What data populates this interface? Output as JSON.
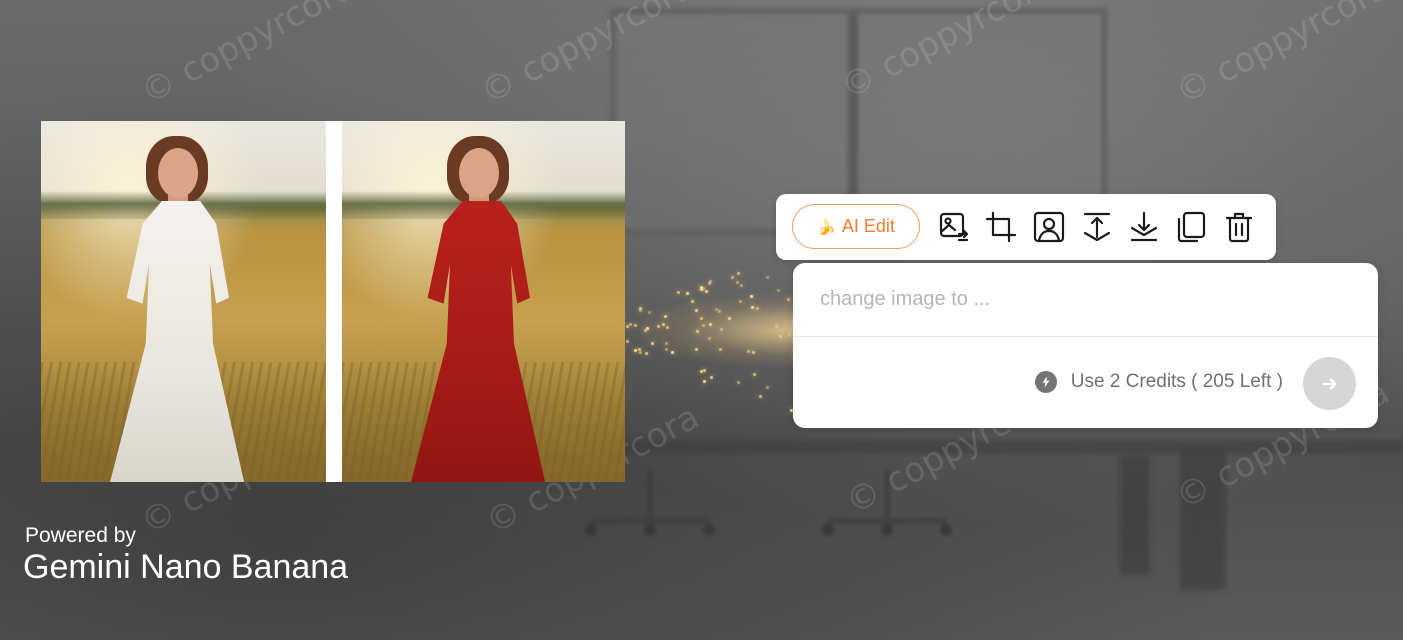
{
  "watermark_text": "© coppyrcora",
  "footer": {
    "powered_label": "Powered by",
    "product_name": "Gemini Nano Banana"
  },
  "toolbar": {
    "ai_edit_label": "AI Edit",
    "ai_edit_emoji": "🍌",
    "accent_color": "#f07c2d",
    "tools": [
      {
        "name": "image-replace-icon"
      },
      {
        "name": "crop-icon"
      },
      {
        "name": "portrait-icon"
      },
      {
        "name": "expand-vertical-icon"
      },
      {
        "name": "compress-vertical-icon"
      },
      {
        "name": "duplicate-icon"
      },
      {
        "name": "delete-icon"
      }
    ]
  },
  "prompt": {
    "placeholder": "change image to ...",
    "credits_text": "Use 2 Credits ( 205 Left )",
    "credits_icon": "lightning-icon",
    "send_icon": "arrow-right-icon"
  },
  "images": {
    "before_dress_color": "#f4f2ee",
    "after_dress_color": "#b8201c"
  }
}
